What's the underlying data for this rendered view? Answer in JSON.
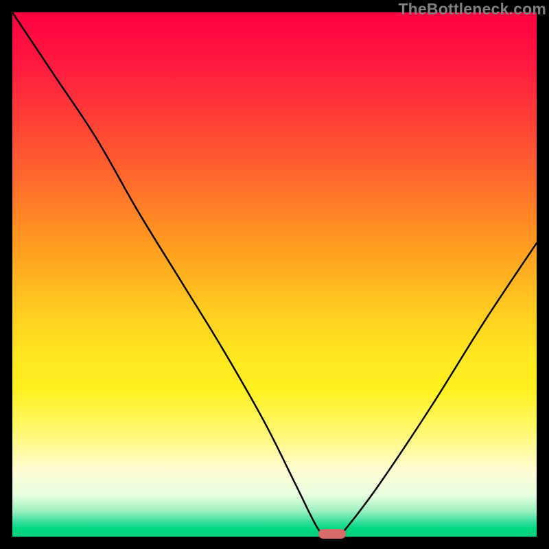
{
  "watermark": "TheBottleneck.com",
  "colors": {
    "background": "#000000",
    "gradient_top": "#ff0040",
    "gradient_mid": "#ffe820",
    "gradient_bottom": "#00d880",
    "curve": "#000000",
    "marker": "#d86a6a"
  },
  "chart_data": {
    "type": "line",
    "title": "",
    "xlabel": "",
    "ylabel": "",
    "xlim": [
      0,
      100
    ],
    "ylim": [
      0,
      100
    ],
    "series": [
      {
        "name": "bottleneck-curve",
        "x": [
          0,
          8,
          16,
          24,
          32,
          40,
          48,
          54,
          58,
          60,
          62,
          64,
          70,
          80,
          90,
          100
        ],
        "values": [
          100,
          88,
          76,
          62,
          49,
          36,
          22,
          10,
          2,
          0,
          0,
          2,
          10,
          25,
          41,
          56
        ]
      }
    ],
    "annotations": [
      {
        "name": "optimal-marker",
        "x": 61,
        "y": 0.5,
        "shape": "pill",
        "color": "#d86a6a"
      }
    ],
    "grid": false,
    "legend": false
  }
}
